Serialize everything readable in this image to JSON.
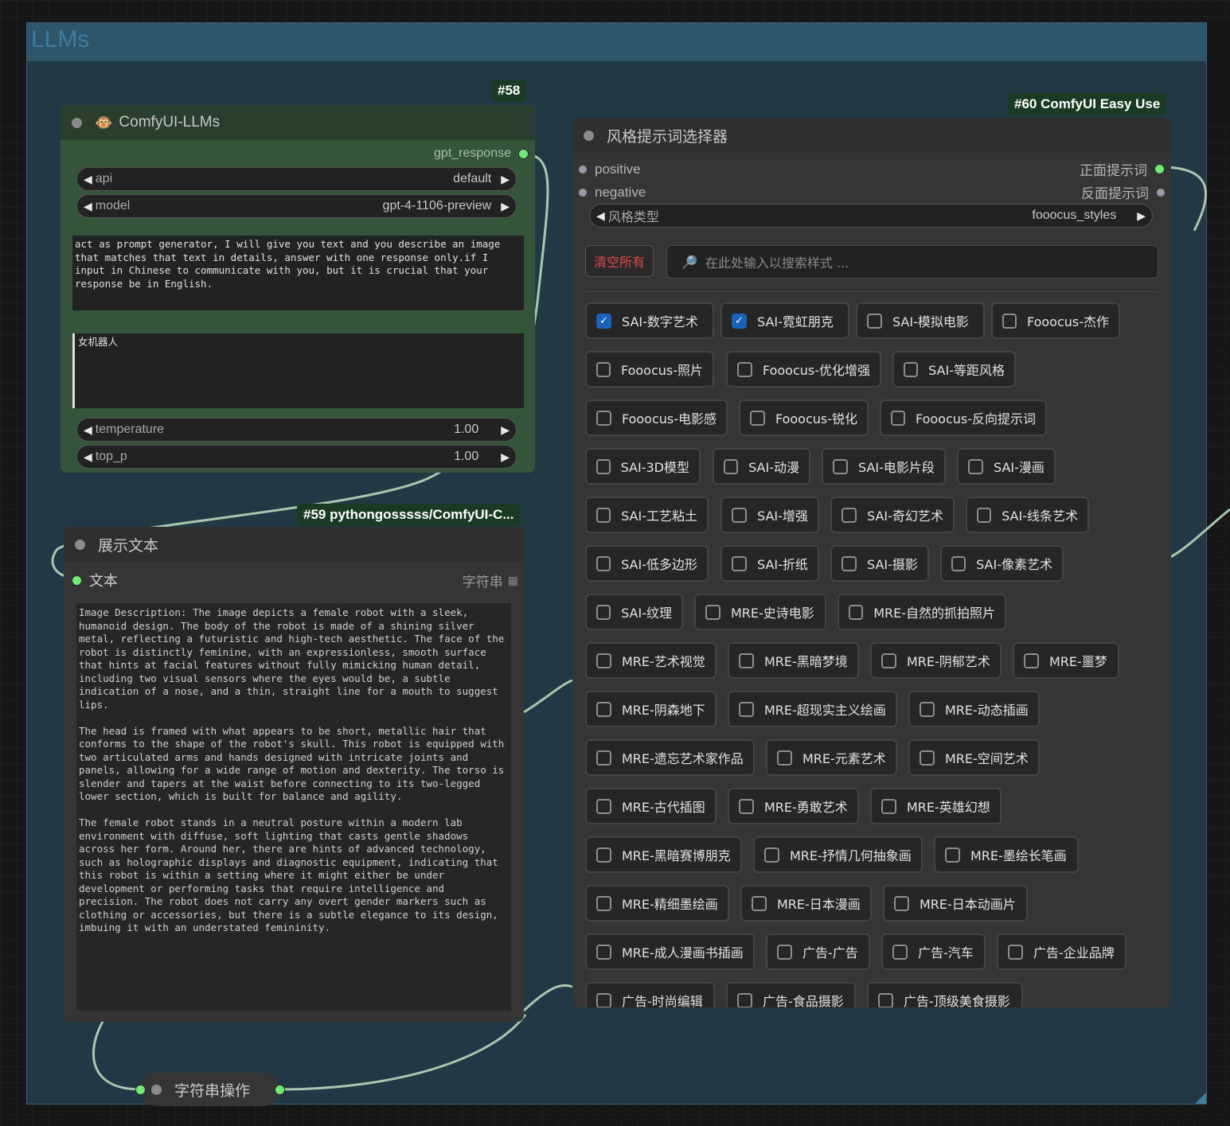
{
  "group": {
    "title": "LLMs"
  },
  "node58": {
    "badge": "#58",
    "title": "ComfyUI-LLMs",
    "title_icon": "monkey-icon",
    "output": "gpt_response",
    "api": {
      "label": "api",
      "value": "default"
    },
    "model": {
      "label": "model",
      "value": "gpt-4-1106-preview"
    },
    "system_prompt": "act as prompt generator, I will give you text and you describe an image that matches that text in details, answer with one response only.if I input in Chinese to communicate with you, but it is crucial that your response be in English.",
    "user_prompt": "女机器人",
    "temperature": {
      "label": "temperature",
      "value": "1.00"
    },
    "top_p": {
      "label": "top_p",
      "value": "1.00"
    }
  },
  "node59": {
    "badge": "#59 pythongosssss/ComfyUI-C...",
    "title": "展示文本",
    "input_label": "文本",
    "input_type": "字符串",
    "text": "Image Description: The image depicts a female robot with a sleek, humanoid design. The body of the robot is made of a shining silver metal, reflecting a futuristic and high-tech aesthetic. The face of the robot is distinctly feminine, with an expressionless, smooth surface that hints at facial features without fully mimicking human detail, including two visual sensors where the eyes would be, a subtle indication of a nose, and a thin, straight line for a mouth to suggest lips.\n\nThe head is framed with what appears to be short, metallic hair that conforms to the shape of the robot's skull. This robot is equipped with two articulated arms and hands designed with intricate joints and panels, allowing for a wide range of motion and dexterity. The torso is slender and tapers at the waist before connecting to its two-legged lower section, which is built for balance and agility.\n\nThe female robot stands in a neutral posture within a modern lab environment with diffuse, soft lighting that casts gentle shadows across her form. Around her, there are hints of advanced technology, such as holographic displays and diagnostic equipment, indicating that this robot is within a setting where it might either be under development or performing tasks that require intelligence and precision. The robot does not carry any overt gender markers such as clothing or accessories, but there is a subtle elegance to its design, imbuing it with an understated femininity."
  },
  "node60": {
    "badge": "#60 ComfyUI Easy Use",
    "title": "风格提示词选择器",
    "inputs": [
      "positive",
      "negative"
    ],
    "outputs": [
      "正面提示词",
      "反面提示词"
    ],
    "style_type": {
      "label": "风格类型",
      "value": "fooocus_styles"
    },
    "clear_label": "清空所有",
    "search_placeholder": "在此处输入以搜索样式 ...",
    "styles": [
      {
        "label": "SAI-数字艺术",
        "checked": true
      },
      {
        "label": "SAI-霓虹朋克",
        "checked": true
      },
      {
        "label": "SAI-模拟电影",
        "checked": false
      },
      {
        "label": "Fooocus-杰作",
        "checked": false
      },
      {
        "label": "Fooocus-照片",
        "checked": false
      },
      {
        "label": "Fooocus-优化增强",
        "checked": false
      },
      {
        "label": "SAI-等距风格",
        "checked": false
      },
      {
        "label": "Fooocus-电影感",
        "checked": false
      },
      {
        "label": "Fooocus-锐化",
        "checked": false
      },
      {
        "label": "Fooocus-反向提示词",
        "checked": false
      },
      {
        "label": "SAI-3D模型",
        "checked": false
      },
      {
        "label": "SAI-动漫",
        "checked": false
      },
      {
        "label": "SAI-电影片段",
        "checked": false
      },
      {
        "label": "SAI-漫画",
        "checked": false
      },
      {
        "label": "SAI-工艺粘土",
        "checked": false
      },
      {
        "label": "SAI-增强",
        "checked": false
      },
      {
        "label": "SAI-奇幻艺术",
        "checked": false
      },
      {
        "label": "SAI-线条艺术",
        "checked": false
      },
      {
        "label": "SAI-低多边形",
        "checked": false
      },
      {
        "label": "SAI-折纸",
        "checked": false
      },
      {
        "label": "SAI-摄影",
        "checked": false
      },
      {
        "label": "SAI-像素艺术",
        "checked": false
      },
      {
        "label": "SAI-纹理",
        "checked": false
      },
      {
        "label": "MRE-史诗电影",
        "checked": false
      },
      {
        "label": "MRE-自然的抓拍照片",
        "checked": false
      },
      {
        "label": "MRE-艺术视觉",
        "checked": false
      },
      {
        "label": "MRE-黑暗梦境",
        "checked": false
      },
      {
        "label": "MRE-阴郁艺术",
        "checked": false
      },
      {
        "label": "MRE-噩梦",
        "checked": false
      },
      {
        "label": "MRE-阴森地下",
        "checked": false
      },
      {
        "label": "MRE-超现实主义绘画",
        "checked": false
      },
      {
        "label": "MRE-动态插画",
        "checked": false
      },
      {
        "label": "MRE-遗忘艺术家作品",
        "checked": false
      },
      {
        "label": "MRE-元素艺术",
        "checked": false
      },
      {
        "label": "MRE-空间艺术",
        "checked": false
      },
      {
        "label": "MRE-古代插图",
        "checked": false
      },
      {
        "label": "MRE-勇敢艺术",
        "checked": false
      },
      {
        "label": "MRE-英雄幻想",
        "checked": false
      },
      {
        "label": "MRE-黑暗赛博朋克",
        "checked": false
      },
      {
        "label": "MRE-抒情几何抽象画",
        "checked": false
      },
      {
        "label": "MRE-墨绘长笔画",
        "checked": false
      },
      {
        "label": "MRE-精细墨绘画",
        "checked": false
      },
      {
        "label": "MRE-日本漫画",
        "checked": false
      },
      {
        "label": "MRE-日本动画片",
        "checked": false
      },
      {
        "label": "MRE-成人漫画书插画",
        "checked": false
      },
      {
        "label": "广告-广告",
        "checked": false
      },
      {
        "label": "广告-汽车",
        "checked": false
      },
      {
        "label": "广告-企业品牌",
        "checked": false
      },
      {
        "label": "广告-时尚编辑",
        "checked": false
      },
      {
        "label": "广告-食品摄影",
        "checked": false
      },
      {
        "label": "广告-顶级美食摄影",
        "checked": false
      }
    ]
  },
  "node_string": {
    "title": "字符串操作"
  }
}
